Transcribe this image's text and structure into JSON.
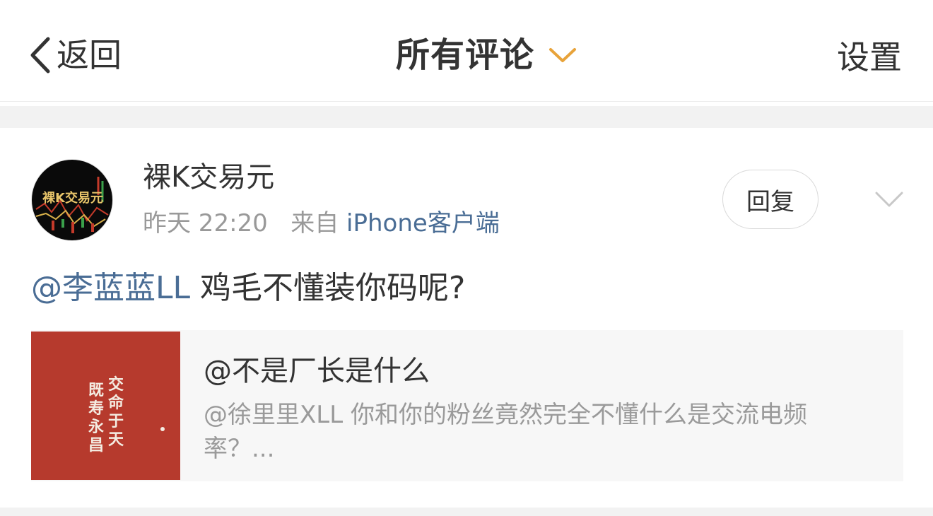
{
  "nav": {
    "back_label": "返回",
    "title": "所有评论",
    "settings_label": "设置",
    "accent_color": "#e8a33a"
  },
  "comment": {
    "avatar_text": "裸K交易元",
    "username": "裸K交易元",
    "time": "昨天 22:20",
    "source_prefix": "来自",
    "source": "iPhone客户端",
    "reply_label": "回复",
    "mention": "@李蓝蓝LL",
    "text": " 鸡毛不懂装你码呢?",
    "quote": {
      "image_col1": "交命于天",
      "image_col2": "既寿永昌",
      "title": "@不是厂长是什么",
      "body": "@徐里里XLL 你和你的粉丝竟然完全不懂什么是交流电频率？..."
    }
  },
  "colors": {
    "link": "#4a6d95",
    "muted": "#999999",
    "quote_image_bg": "#b63a2d"
  }
}
